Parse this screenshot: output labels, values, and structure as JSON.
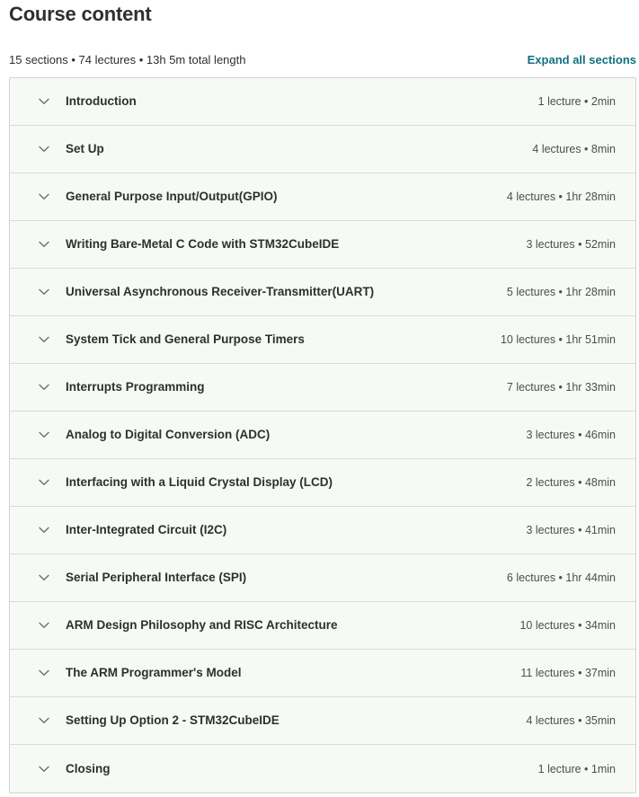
{
  "header": {
    "title": "Course content",
    "summary": "15 sections • 74 lectures • 13h 5m total length",
    "expand_all_label": "Expand all sections",
    "accent_color": "#10707f",
    "sections_count": 15,
    "lectures_count": 74,
    "total_length": "13h 5m"
  },
  "panel": {
    "background_color": "#f7f9f4",
    "border_color": "#d1d2d4",
    "divider_color": "#d9dcd6",
    "chevron_icon": "chevron-down-icon",
    "collapsed": true
  },
  "sections": [
    {
      "title": "Introduction",
      "meta": "1 lecture • 2min",
      "lectures": "1 lecture",
      "duration": "2min"
    },
    {
      "title": "Set Up",
      "meta": "4 lectures • 8min",
      "lectures": "4 lectures",
      "duration": "8min"
    },
    {
      "title": "General Purpose Input/Output(GPIO)",
      "meta": "4 lectures • 1hr 28min",
      "lectures": "4 lectures",
      "duration": "1hr 28min"
    },
    {
      "title": "Writing Bare-Metal C Code with STM32CubeIDE",
      "meta": "3 lectures • 52min",
      "lectures": "3 lectures",
      "duration": "52min"
    },
    {
      "title": "Universal Asynchronous Receiver-Transmitter(UART)",
      "meta": "5 lectures • 1hr 28min",
      "lectures": "5 lectures",
      "duration": "1hr 28min"
    },
    {
      "title": "System Tick and General Purpose Timers",
      "meta": "10 lectures • 1hr 51min",
      "lectures": "10 lectures",
      "duration": "1hr 51min"
    },
    {
      "title": "Interrupts Programming",
      "meta": "7 lectures • 1hr 33min",
      "lectures": "7 lectures",
      "duration": "1hr 33min"
    },
    {
      "title": "Analog to Digital Conversion (ADC)",
      "meta": "3 lectures • 46min",
      "lectures": "3 lectures",
      "duration": "46min"
    },
    {
      "title": "Interfacing with a Liquid Crystal Display (LCD)",
      "meta": "2 lectures • 48min",
      "lectures": "2 lectures",
      "duration": "48min"
    },
    {
      "title": "Inter-Integrated Circuit (I2C)",
      "meta": "3 lectures • 41min",
      "lectures": "3 lectures",
      "duration": "41min"
    },
    {
      "title": "Serial Peripheral Interface (SPI)",
      "meta": "6 lectures • 1hr 44min",
      "lectures": "6 lectures",
      "duration": "1hr 44min"
    },
    {
      "title": "ARM Design Philosophy and RISC Architecture",
      "meta": "10 lectures • 34min",
      "lectures": "10 lectures",
      "duration": "34min"
    },
    {
      "title": "The ARM Programmer's Model",
      "meta": "11 lectures • 37min",
      "lectures": "11 lectures",
      "duration": "37min"
    },
    {
      "title": "Setting Up Option 2 - STM32CubeIDE",
      "meta": "4 lectures • 35min",
      "lectures": "4 lectures",
      "duration": "35min"
    },
    {
      "title": "Closing",
      "meta": "1 lecture • 1min",
      "lectures": "1 lecture",
      "duration": "1min"
    }
  ]
}
